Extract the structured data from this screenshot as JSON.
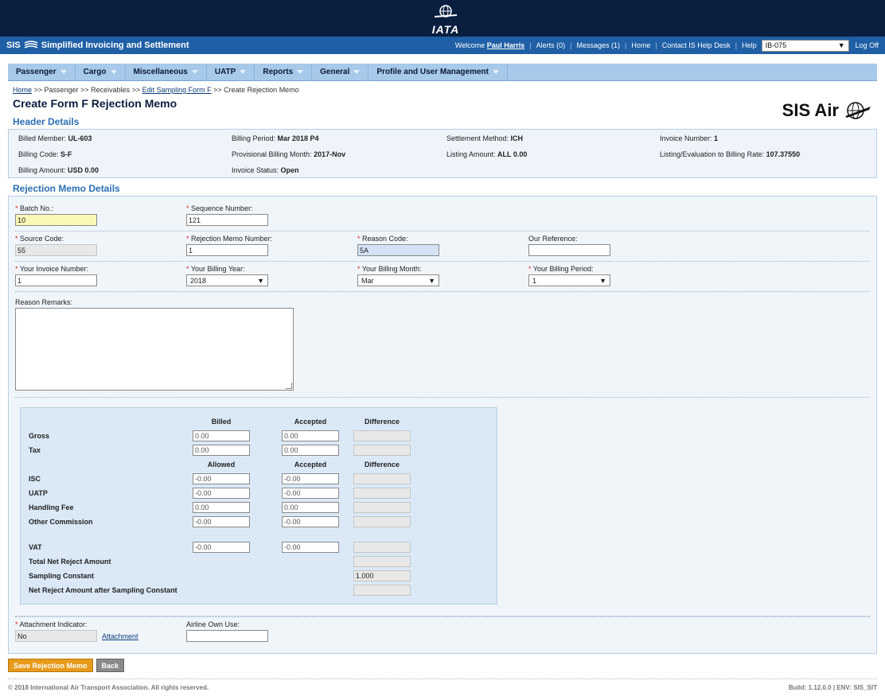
{
  "topbar": {
    "logo_text": "IATA"
  },
  "sisbar": {
    "brand": "Simplified Invoicing and Settlement",
    "brand_prefix": "SIS",
    "welcome": "Welcome",
    "user": "Paul Harris",
    "alerts": "Alerts (0)",
    "messages": "Messages (1)",
    "home": "Home",
    "contact": "Contact IS Help Desk",
    "help": "Help",
    "member_select": "IB-075",
    "logoff": "Log Off"
  },
  "nav": [
    "Passenger",
    "Cargo",
    "Miscellaneous",
    "UATP",
    "Reports",
    "General",
    "Profile and User Management"
  ],
  "breadcrumb": {
    "home": "Home",
    "part2": " >> Passenger >> Receivables >> ",
    "link": "Edit Sampling Form F",
    "part3": " >> Create Rejection Memo"
  },
  "page_title": "Create Form F Rejection Memo",
  "brand_logo_text": "SIS Air",
  "header_details": {
    "title": "Header Details",
    "items": [
      {
        "label": "Billed Member: ",
        "value": "UL-603"
      },
      {
        "label": "Billing Period: ",
        "value": "Mar 2018 P4"
      },
      {
        "label": "Settlement Method: ",
        "value": "ICH"
      },
      {
        "label": "Invoice Number: ",
        "value": "1"
      },
      {
        "label": "Billing Code: ",
        "value": "S-F"
      },
      {
        "label": "Provisional Billing Month: ",
        "value": "2017-Nov"
      },
      {
        "label": "Listing Amount: ",
        "value": "ALL 0.00"
      },
      {
        "label": "Listing/Evaluation to Billing Rate: ",
        "value": "107.37550"
      },
      {
        "label": "Billing Amount: ",
        "value": "USD 0.00"
      },
      {
        "label": "Invoice Status: ",
        "value": "Open"
      }
    ]
  },
  "rejection": {
    "title": "Rejection Memo Details",
    "batch_label": "Batch No.:",
    "batch_value": "10",
    "seq_label": "Sequence Number:",
    "seq_value": "121",
    "source_label": "Source Code:",
    "source_value": "55",
    "rm_number_label": "Rejection Memo Number:",
    "rm_number_value": "1",
    "reason_code_label": "Reason Code:",
    "reason_code_value": "5A",
    "our_ref_label": "Our Reference:",
    "our_ref_value": "",
    "your_invoice_label": "Your Invoice Number:",
    "your_invoice_value": "1",
    "your_year_label": "Your Billing Year:",
    "your_year_value": "2018",
    "your_month_label": "Your Billing Month:",
    "your_month_value": "Mar",
    "your_period_label": "Your Billing Period:",
    "your_period_value": "1",
    "remarks_label": "Reason Remarks:",
    "attach_label": "Attachment Indicator:",
    "attach_value": "No",
    "attach_link": "Attachment",
    "own_use_label": "Airline Own Use:",
    "own_use_value": ""
  },
  "amounts": {
    "hdr1": [
      "Billed",
      "Accepted",
      "Difference"
    ],
    "hdr2": [
      "Allowed",
      "Accepted",
      "Difference"
    ],
    "gross": {
      "label": "Gross",
      "a": "0.00",
      "b": "0.00"
    },
    "tax": {
      "label": "Tax",
      "a": "0.00",
      "b": "0.00"
    },
    "isc": {
      "label": "ISC",
      "a": "-0.00",
      "b": "-0.00"
    },
    "uatp": {
      "label": "UATP",
      "a": "-0.00",
      "b": "-0.00"
    },
    "handling": {
      "label": "Handling Fee",
      "a": "0.00",
      "b": "0.00"
    },
    "other": {
      "label": "Other Commission",
      "a": "-0.00",
      "b": "-0.00"
    },
    "vat": {
      "label": "VAT",
      "a": "-0.00",
      "b": "-0.00"
    },
    "total_net": {
      "label": "Total Net Reject Amount"
    },
    "sampling": {
      "label": "Sampling Constant",
      "value": "1.000"
    },
    "net_after": {
      "label": "Net Reject Amount after Sampling Constant"
    }
  },
  "buttons": {
    "save": "Save Rejection Memo",
    "back": "Back"
  },
  "footer": {
    "copyright": "© 2018 International Air Transport Association. All rights reserved.",
    "build": "Build: 1.12.0.0 | ENV: SIS_SIT"
  }
}
